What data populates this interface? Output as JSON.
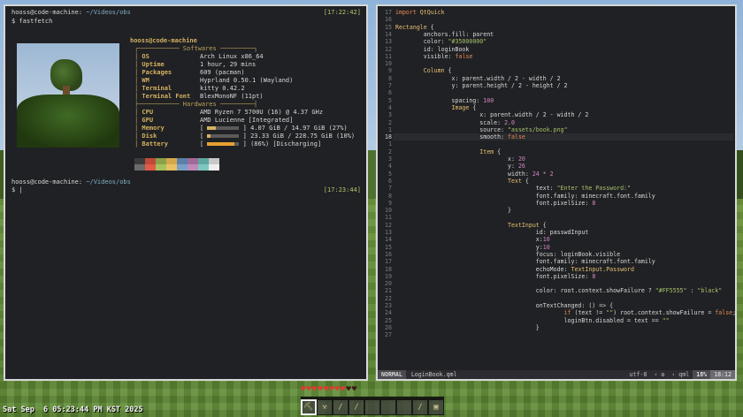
{
  "left_terminal": {
    "prompt1_user": "hooss@code-machine:",
    "prompt1_path": " ~/Videos/obs",
    "prompt1_time": "[17:22:42]",
    "command": "$ fastfetch",
    "userhost": "hooss@code-machine",
    "section_software": "Softwares",
    "section_hardware": "Hardwares",
    "rows": [
      {
        "key": "OS",
        "value": "Arch Linux x86_64"
      },
      {
        "key": "Uptime",
        "value": "1 hour, 29 mins"
      },
      {
        "key": "Packages",
        "value": "609 (pacman)"
      },
      {
        "key": "WM",
        "value": "Hyprland 0.50.1 (Wayland)"
      },
      {
        "key": "Terminal",
        "value": "kitty 0.42.2"
      },
      {
        "key": "Terminal Font",
        "value": "BlexMonoNF (11pt)"
      },
      {
        "key": "CPU",
        "value": "AMD Ryzen 7 5700U (16) @ 4.37 GHz"
      },
      {
        "key": "GPU",
        "value": "AMD Lucienne [Integrated]"
      },
      {
        "key": "Memory",
        "value": "4.07 GiB / 14.97 GiB (27%)",
        "bar": 0.27
      },
      {
        "key": "Disk",
        "value": "23.33 GiB / 228.75 GiB (10%)",
        "bar": 0.1
      },
      {
        "key": "Battery",
        "value": "(86%) [Discharging]",
        "bar": 0.86
      }
    ],
    "prompt2_user": "hooss@code-machine:",
    "prompt2_path": " ~/Videos/obs",
    "prompt2_time": "[17:23:44]",
    "prompt2_cmd": "$ |",
    "palette_top": [
      "#3b3b3b",
      "#c04a3a",
      "#8aa14a",
      "#d4a84a",
      "#5a7fa8",
      "#a06a9a",
      "#5ea8a0",
      "#c8c8c8"
    ],
    "palette_bottom": [
      "#6b6b6b",
      "#e25a48",
      "#a8c25e",
      "#e8c060",
      "#7aa0c8",
      "#c08ab8",
      "#7cc8c0",
      "#eeeeee"
    ]
  },
  "editor": {
    "first_line": 17,
    "cursor_line": 10,
    "lines": [
      {
        "n": "17",
        "t": [
          [
            "kw",
            "import "
          ],
          [
            "ty",
            "QtQuick"
          ]
        ]
      },
      {
        "n": "16",
        "t": []
      },
      {
        "n": "15",
        "t": [
          [
            "ty",
            "Rectangle "
          ],
          [
            "",
            "{"
          ]
        ]
      },
      {
        "n": "14",
        "t": [
          [
            "",
            "        anchors.fill: parent"
          ]
        ]
      },
      {
        "n": "13",
        "t": [
          [
            "",
            "        color: "
          ],
          [
            "str",
            "\"#35000000\""
          ]
        ]
      },
      {
        "n": "12",
        "t": [
          [
            "",
            "        id: loginBook"
          ]
        ]
      },
      {
        "n": "11",
        "t": [
          [
            "",
            "        visible: "
          ],
          [
            "kw",
            "false"
          ]
        ]
      },
      {
        "n": "10",
        "t": []
      },
      {
        "n": "9",
        "t": [
          [
            "ty",
            "        Column "
          ],
          [
            "",
            "{"
          ]
        ]
      },
      {
        "n": "8",
        "t": [
          [
            "",
            "                x: parent.width / 2 - width / 2"
          ]
        ]
      },
      {
        "n": "7",
        "t": [
          [
            "",
            "                y: parent.height / 2 - height / 2"
          ]
        ]
      },
      {
        "n": "6",
        "t": []
      },
      {
        "n": "5",
        "t": [
          [
            "",
            "                spacing: "
          ],
          [
            "num",
            "100"
          ]
        ]
      },
      {
        "n": "4",
        "t": [
          [
            "ty",
            "                Image "
          ],
          [
            "",
            "{"
          ]
        ]
      },
      {
        "n": "3",
        "t": [
          [
            "",
            "                        x: parent.width / 2 - width / 2"
          ]
        ]
      },
      {
        "n": "2",
        "t": [
          [
            "",
            "                        scale: "
          ],
          [
            "num",
            "2.0"
          ]
        ]
      },
      {
        "n": "1",
        "t": [
          [
            "",
            "                        source: "
          ],
          [
            "str",
            "\"assets/book.png\""
          ]
        ]
      },
      {
        "n": "18",
        "t": [
          [
            "",
            "                        smooth: "
          ],
          [
            "kw",
            "false"
          ]
        ]
      },
      {
        "n": "1",
        "t": []
      },
      {
        "n": "2",
        "t": [
          [
            "ty",
            "                        Item "
          ],
          [
            "",
            "{"
          ]
        ]
      },
      {
        "n": "3",
        "t": [
          [
            "",
            "                                x: "
          ],
          [
            "num",
            "20"
          ]
        ]
      },
      {
        "n": "4",
        "t": [
          [
            "",
            "                                y: "
          ],
          [
            "num",
            "26"
          ]
        ]
      },
      {
        "n": "5",
        "t": [
          [
            "",
            "                                width: "
          ],
          [
            "num",
            "24 * 2"
          ]
        ]
      },
      {
        "n": "6",
        "t": [
          [
            "ty",
            "                                Text "
          ],
          [
            "",
            "{"
          ]
        ]
      },
      {
        "n": "7",
        "t": [
          [
            "",
            "                                        text: "
          ],
          [
            "str",
            "\"Enter the Password:\""
          ]
        ]
      },
      {
        "n": "8",
        "t": [
          [
            "",
            "                                        font.family: minecraft.font.family"
          ]
        ]
      },
      {
        "n": "9",
        "t": [
          [
            "",
            "                                        font.pixelSize: "
          ],
          [
            "num",
            "8"
          ]
        ]
      },
      {
        "n": "10",
        "t": [
          [
            "",
            "                                }"
          ]
        ]
      },
      {
        "n": "11",
        "t": []
      },
      {
        "n": "12",
        "t": [
          [
            "ty",
            "                                TextInput "
          ],
          [
            "",
            "{"
          ]
        ]
      },
      {
        "n": "13",
        "t": [
          [
            "",
            "                                        id: passwdInput"
          ]
        ]
      },
      {
        "n": "14",
        "t": [
          [
            "",
            "                                        x:"
          ],
          [
            "num",
            "10"
          ]
        ]
      },
      {
        "n": "15",
        "t": [
          [
            "",
            "                                        y:"
          ],
          [
            "num",
            "10"
          ]
        ]
      },
      {
        "n": "16",
        "t": [
          [
            "",
            "                                        focus: loginBook.visible"
          ]
        ]
      },
      {
        "n": "17",
        "t": [
          [
            "",
            "                                        font.family: minecraft.font.family"
          ]
        ]
      },
      {
        "n": "18",
        "t": [
          [
            "",
            "                                        echoMode: "
          ],
          [
            "ty",
            "TextInput.Password"
          ]
        ]
      },
      {
        "n": "19",
        "t": [
          [
            "",
            "                                        font.pixelSize: "
          ],
          [
            "num",
            "8"
          ]
        ]
      },
      {
        "n": "20",
        "t": []
      },
      {
        "n": "21",
        "t": [
          [
            "",
            "                                        color: root.context.showFailure ? "
          ],
          [
            "str",
            "\"#FF5555\""
          ],
          [
            "",
            " : "
          ],
          [
            "str",
            "\"black\""
          ]
        ]
      },
      {
        "n": "22",
        "t": []
      },
      {
        "n": "23",
        "t": [
          [
            "",
            "                                        onTextChanged: () => {"
          ]
        ]
      },
      {
        "n": "24",
        "t": [
          [
            "",
            "                                                "
          ],
          [
            "kw",
            "if "
          ],
          [
            "",
            "(text != "
          ],
          [
            "str",
            "\"\""
          ],
          [
            "",
            ") root.context.showFailure = "
          ],
          [
            "kw",
            "false"
          ],
          [
            "",
            ";"
          ]
        ]
      },
      {
        "n": "25",
        "t": [
          [
            "",
            "                                                loginBtn.disabled = text == "
          ],
          [
            "str",
            "\"\""
          ]
        ]
      },
      {
        "n": "26",
        "t": [
          [
            "",
            "                                        }"
          ]
        ]
      },
      {
        "n": "27",
        "t": []
      }
    ],
    "status_mode": "NORMAL",
    "status_file": "LoginBook.qml",
    "status_enc": "utf-8",
    "status_os": "‹ ⚙",
    "status_ft": "‹ qml",
    "status_pct": "18%",
    "status_pos": "18:12"
  },
  "hud": {
    "clock": "Sat Sep  6 05:23:44 PM KST 2025",
    "hearts_full": 8,
    "hearts_total": 10,
    "hotbar": [
      "⛏",
      "⚒",
      "/",
      "/",
      "",
      "",
      "",
      "/",
      "▣"
    ],
    "hotbar_selected": 0
  }
}
